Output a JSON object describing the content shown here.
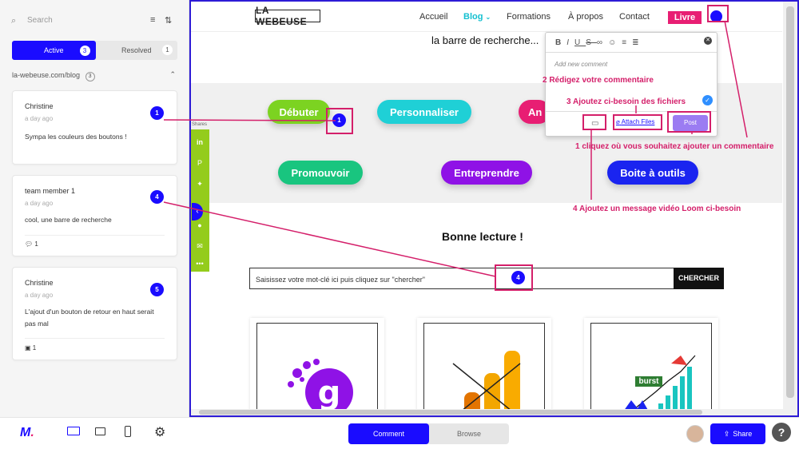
{
  "sidebar": {
    "search_placeholder": "Search",
    "tab_active": "Active",
    "tab_active_count": "3",
    "tab_resolved": "Resolved",
    "tab_resolved_count": "1",
    "group_label": "la-webeuse.com/blog",
    "group_count": "3",
    "comments": [
      {
        "author": "Christine",
        "time": "a day ago",
        "text": "Sympa les couleurs des boutons !",
        "pin": "1",
        "meta": ""
      },
      {
        "author": "team member 1",
        "time": "a day ago",
        "text": "cool, une barre de recherche",
        "pin": "4",
        "meta": "1"
      },
      {
        "author": "Christine",
        "time": "a day ago",
        "text": "L'ajout d'un bouton de retour en haut serait pas mal",
        "pin": "5",
        "meta": "1"
      }
    ]
  },
  "site": {
    "logo": "LA WEBEUSE",
    "nav": [
      "Accueil",
      "Blog",
      "Formations",
      "À propos",
      "Contact"
    ],
    "nav_cta": "Livre",
    "heading_top": "la barre de recherche...",
    "buttons": [
      "Débuter",
      "Personnaliser",
      "An",
      "Promouvoir",
      "Entreprendre",
      "Boite à outils"
    ],
    "share_label": "Shares",
    "section_title": "Bonne lecture !",
    "search_placeholder": "Saisissez votre mot-clé ici puis cliquez sur \"chercher\"",
    "search_button": "CHERCHER",
    "badge_burst": "burst",
    "pin_1": "1",
    "pin_4": "4"
  },
  "popup": {
    "placeholder": "Add new comment",
    "attach": "Attach Files",
    "post": "Post"
  },
  "annotations": {
    "a1": "1 cliquez où vous souhaitez ajouter un commentaire",
    "a2": "2 Rédigez votre commentaire",
    "a3": "3  Ajoutez ci-besoin des fichiers",
    "a4": "4 Ajoutez un message vidéo Loom ci-besoin"
  },
  "bottom": {
    "comment": "Comment",
    "browse": "Browse",
    "share": "Share",
    "help": "?"
  },
  "colors": {
    "accent": "#1a0cff",
    "annotation": "#d41f6a",
    "share_bar": "#94cc1c"
  }
}
